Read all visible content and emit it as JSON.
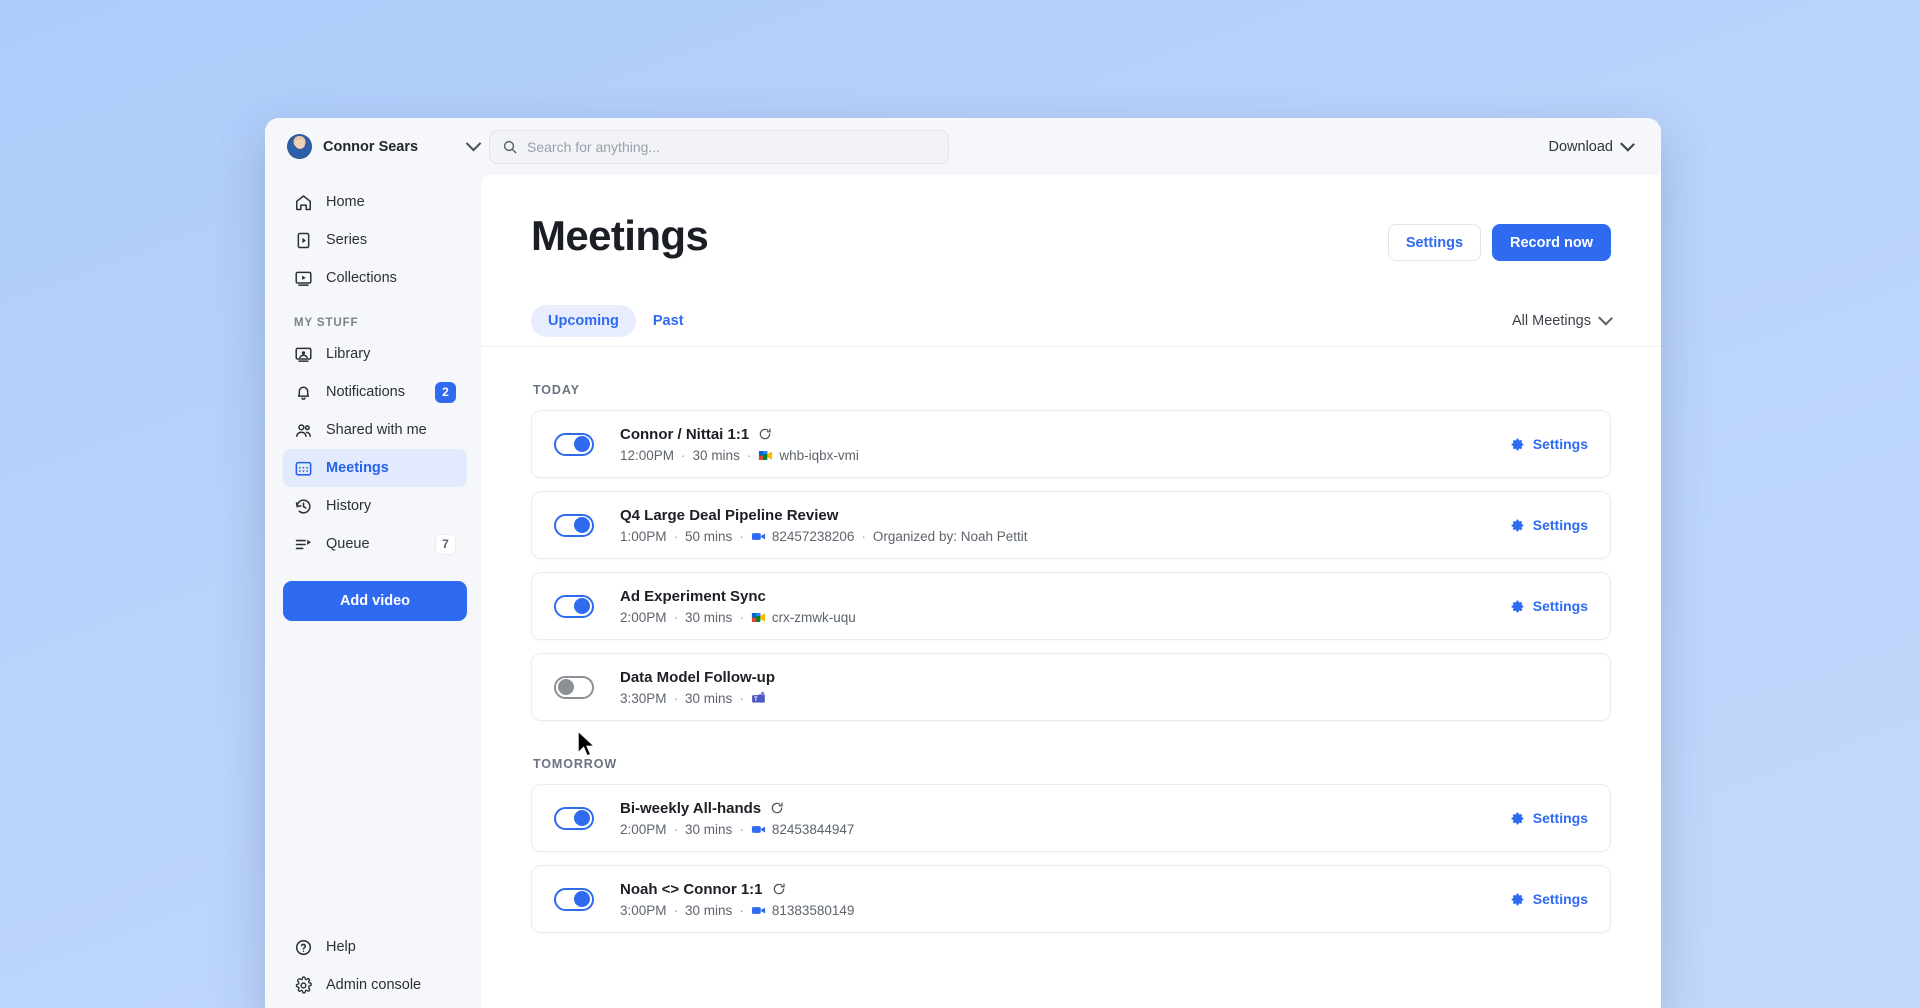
{
  "topbar": {
    "user_name": "Connor Sears",
    "avatar_icon": "user-avatar",
    "user_chevron_icon": "chevron-down-icon",
    "search": {
      "icon": "search-icon",
      "placeholder": "Search for anything..."
    },
    "download_label": "Download",
    "download_chevron_icon": "chevron-down-icon"
  },
  "sidebar": {
    "top_items": [
      {
        "label": "Home",
        "icon": "home-icon"
      },
      {
        "label": "Series",
        "icon": "series-icon"
      },
      {
        "label": "Collections",
        "icon": "collections-icon"
      }
    ],
    "section_label": "MY STUFF",
    "stuff_items": [
      {
        "label": "Library",
        "icon": "library-icon",
        "badge": null,
        "active": false
      },
      {
        "label": "Notifications",
        "icon": "bell-icon",
        "badge": "2",
        "badge_style": "blue",
        "active": false
      },
      {
        "label": "Shared with me",
        "icon": "people-icon",
        "badge": null,
        "active": false
      },
      {
        "label": "Meetings",
        "icon": "calendar-icon",
        "badge": null,
        "active": true
      },
      {
        "label": "History",
        "icon": "history-icon",
        "badge": null,
        "active": false
      },
      {
        "label": "Queue",
        "icon": "queue-icon",
        "badge": "7",
        "badge_style": "plain",
        "active": false
      }
    ],
    "add_video_label": "Add video",
    "bottom_items": [
      {
        "label": "Help",
        "icon": "help-circle-icon"
      },
      {
        "label": "Admin console",
        "icon": "gear-icon"
      }
    ]
  },
  "main": {
    "page_title": "Meetings",
    "settings_button": "Settings",
    "record_button": "Record now",
    "tabs": [
      {
        "label": "Upcoming",
        "active": true
      },
      {
        "label": "Past",
        "active": false
      }
    ],
    "filter_label": "All Meetings",
    "filter_chevron_icon": "chevron-down-icon",
    "row_settings_label": "Settings",
    "groups": [
      {
        "day_label": "TODAY",
        "meetings": [
          {
            "title": "Connor / Nittai 1:1",
            "recurring": true,
            "toggle": "on",
            "time": "12:00PM",
            "duration": "30 mins",
            "platform": "google-meet",
            "code": "whb-iqbx-vmi",
            "organizer": null,
            "has_settings": true
          },
          {
            "title": "Q4 Large Deal Pipeline Review",
            "recurring": false,
            "toggle": "on",
            "time": "1:00PM",
            "duration": "50 mins",
            "platform": "zoom",
            "code": "82457238206",
            "organizer": "Organized by: Noah Pettit",
            "has_settings": true
          },
          {
            "title": "Ad Experiment Sync",
            "recurring": false,
            "toggle": "on",
            "time": "2:00PM",
            "duration": "30 mins",
            "platform": "google-meet",
            "code": "crx-zmwk-uqu",
            "organizer": null,
            "has_settings": true
          },
          {
            "title": "Data Model Follow-up",
            "recurring": false,
            "toggle": "off",
            "time": "3:30PM",
            "duration": "30 mins",
            "platform": "microsoft-teams",
            "code": "",
            "organizer": null,
            "has_settings": false
          }
        ]
      },
      {
        "day_label": "TOMORROW",
        "meetings": [
          {
            "title": "Bi-weekly All-hands",
            "recurring": true,
            "toggle": "on",
            "time": "2:00PM",
            "duration": "30 mins",
            "platform": "zoom",
            "code": "82453844947",
            "organizer": null,
            "has_settings": true
          },
          {
            "title": "Noah <> Connor 1:1",
            "recurring": true,
            "toggle": "on",
            "time": "3:00PM",
            "duration": "30 mins",
            "platform": "zoom",
            "code": "81383580149",
            "organizer": null,
            "has_settings": true
          }
        ]
      }
    ]
  },
  "colors": {
    "accent": "#2f6bf0",
    "accent_soft": "#e4eafd",
    "desktop": "#aecbfa",
    "text": "#1c1f25",
    "muted": "#5d646e"
  }
}
